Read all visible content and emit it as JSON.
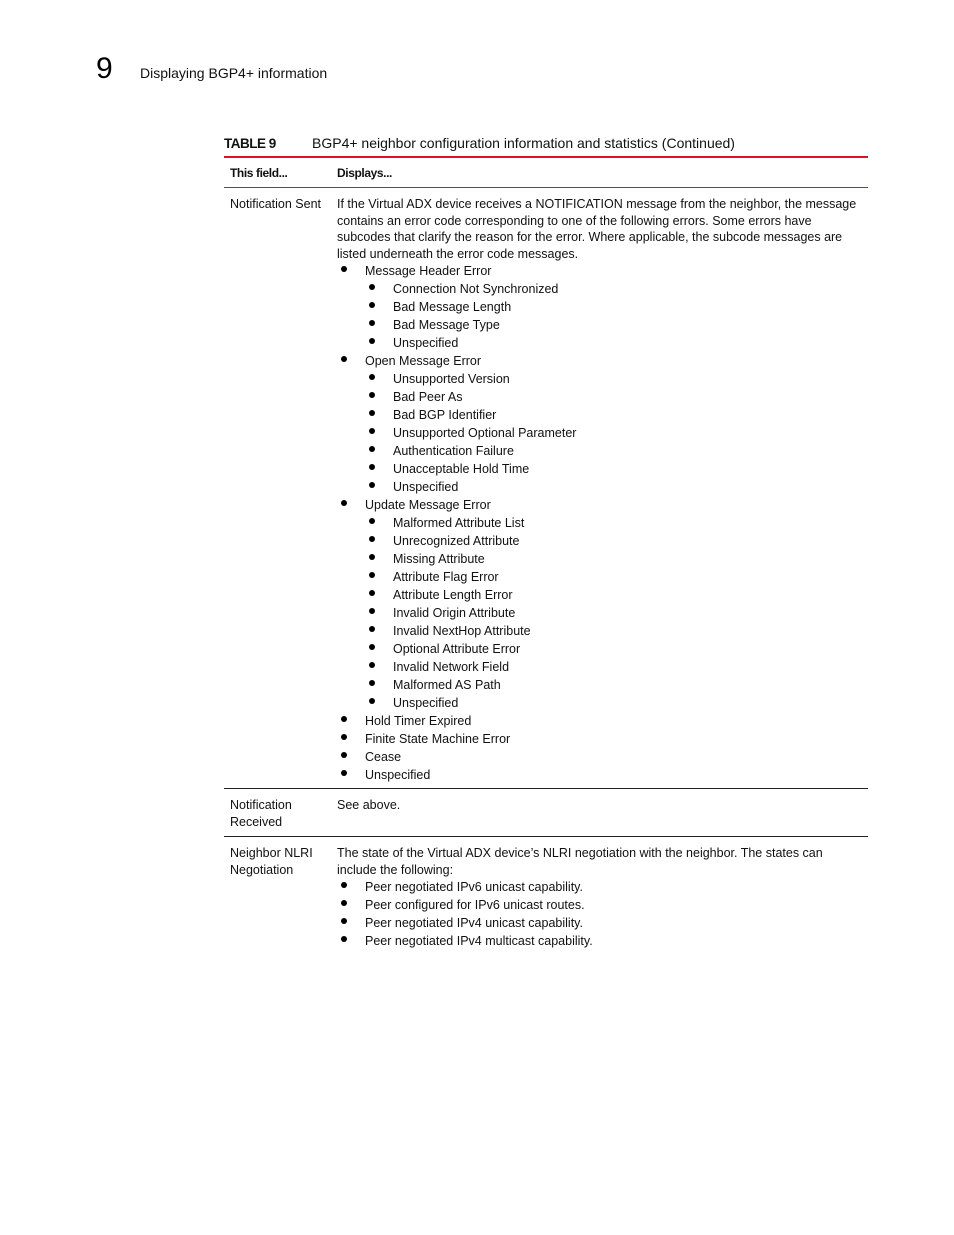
{
  "header": {
    "chapter_number": "9",
    "chapter_title": "Displaying BGP4+ information"
  },
  "table": {
    "label": "TABLE 9",
    "caption": "BGP4+ neighbor configuration information and statistics  (Continued)",
    "columns": [
      "This field...",
      "Displays..."
    ],
    "rows": [
      {
        "field": "Notification Sent",
        "description": "If the Virtual ADX device receives a NOTIFICATION message from the neighbor, the message contains an error code corresponding to one of the following errors. Some errors have subcodes that clarify the reason for the error. Where applicable, the subcode messages are listed underneath the error code messages.",
        "items": [
          {
            "label": "Message Header Error",
            "subitems": [
              "Connection Not Synchronized",
              "Bad Message Length",
              "Bad Message Type",
              "Unspecified"
            ]
          },
          {
            "label": "Open Message Error",
            "subitems": [
              "Unsupported Version",
              "Bad Peer As",
              "Bad BGP Identifier",
              "Unsupported Optional Parameter",
              "Authentication Failure",
              "Unacceptable Hold Time",
              "Unspecified"
            ]
          },
          {
            "label": "Update Message Error",
            "subitems": [
              "Malformed Attribute List",
              "Unrecognized Attribute",
              "Missing Attribute",
              "Attribute Flag Error",
              "Attribute Length Error",
              "Invalid Origin Attribute",
              "Invalid NextHop Attribute",
              "Optional Attribute Error",
              "Invalid Network Field",
              "Malformed AS Path",
              "Unspecified"
            ]
          },
          {
            "label": "Hold Timer Expired",
            "subitems": []
          },
          {
            "label": "Finite State Machine Error",
            "subitems": []
          },
          {
            "label": "Cease",
            "subitems": []
          },
          {
            "label": "Unspecified",
            "subitems": []
          }
        ]
      },
      {
        "field": "Notification Received",
        "description": "See above.",
        "items": []
      },
      {
        "field": "Neighbor NLRI Negotiation",
        "description": "The state of the Virtual ADX device’s NLRI negotiation with the neighbor. The states can include the following:",
        "items": [
          {
            "label": "Peer negotiated IPv6 unicast capability.",
            "subitems": []
          },
          {
            "label": "Peer configured for IPv6 unicast routes.",
            "subitems": []
          },
          {
            "label": "Peer negotiated IPv4 unicast capability.",
            "subitems": []
          },
          {
            "label": "Peer negotiated IPv4 multicast capability.",
            "subitems": []
          }
        ]
      }
    ]
  }
}
